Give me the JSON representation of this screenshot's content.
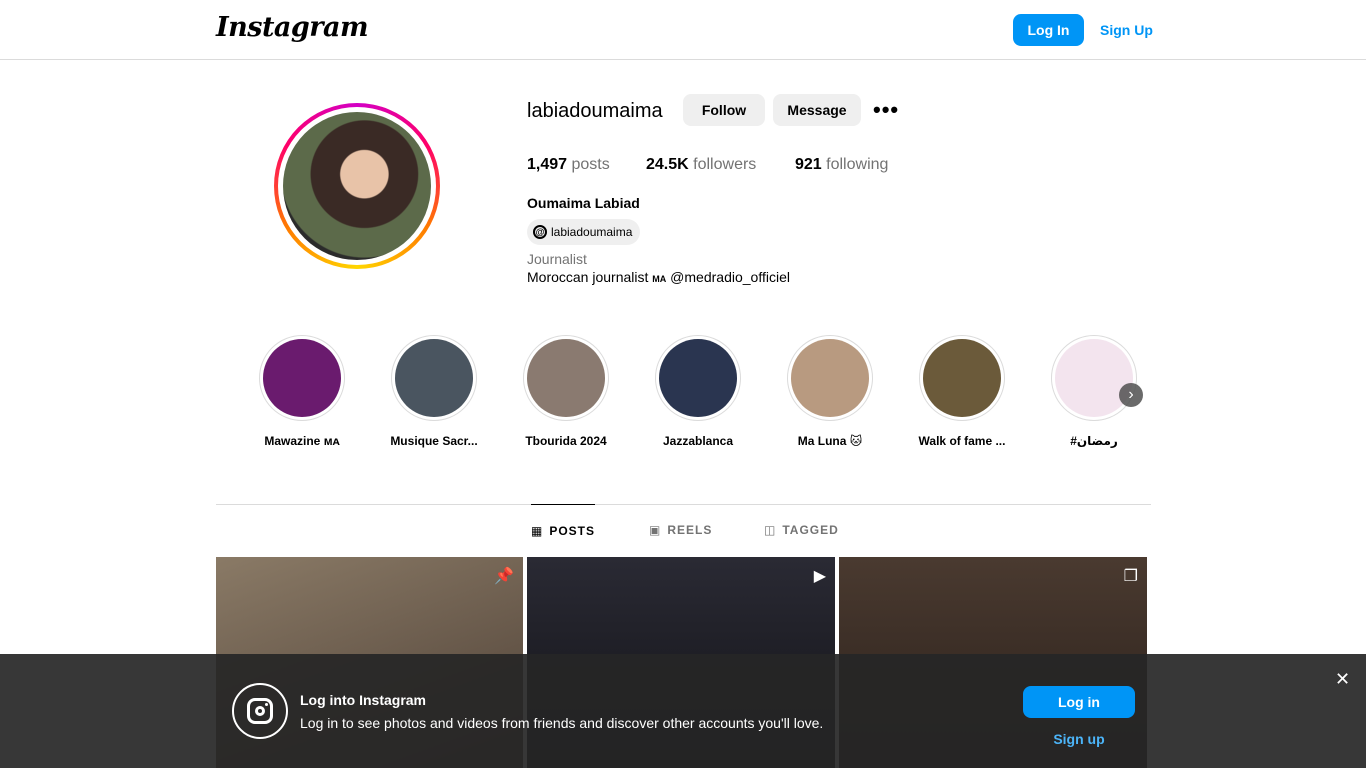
{
  "header": {
    "logo": "Instagram",
    "login_label": "Log In",
    "signup_label": "Sign Up"
  },
  "profile": {
    "username": "labiadoumaima",
    "follow_label": "Follow",
    "message_label": "Message",
    "more_icon": "•••",
    "posts_count": "1,497",
    "posts_label": "posts",
    "followers_count": "24.5K",
    "followers_label": "followers",
    "following_count": "921",
    "following_label": "following",
    "full_name": "Oumaima Labiad",
    "threads_handle": "labiadoumaima",
    "threads_icon": "@",
    "category": "Journalist",
    "bio": "Moroccan journalist",
    "bio_flag": "MA",
    "bio_mention": "@medradio_officiel"
  },
  "highlights": [
    {
      "label": "Mawazine ᴍᴀ",
      "color": "#6a1b6e"
    },
    {
      "label": "Musique Sacr...",
      "color": "#4a5560"
    },
    {
      "label": "Tbourida 2024",
      "color": "#8a7a70"
    },
    {
      "label": "Jazzablanca",
      "color": "#2a3550"
    },
    {
      "label": "Ma Luna 🐱",
      "color": "#b89a80"
    },
    {
      "label": "Walk of fame ...",
      "color": "#6b5a3a"
    },
    {
      "label": "#رمضان",
      "color": "#f3e4ee"
    }
  ],
  "highlight_next_icon": "›",
  "tabs": [
    {
      "label": "POSTS",
      "icon": "▦"
    },
    {
      "label": "REELS",
      "icon": "▣"
    },
    {
      "label": "TAGGED",
      "icon": "◫"
    }
  ],
  "posts": [
    {
      "badge": "📌",
      "color": "#6b5c4e"
    },
    {
      "badge": "▶",
      "color": "#1e1e24"
    },
    {
      "badge": "❐",
      "color": "#3d2e28"
    }
  ],
  "banner": {
    "title": "Log into Instagram",
    "text": "Log in to see photos and videos from friends and discover other accounts you'll love.",
    "login_label": "Log in",
    "signup_label": "Sign up",
    "close_icon": "✕"
  }
}
